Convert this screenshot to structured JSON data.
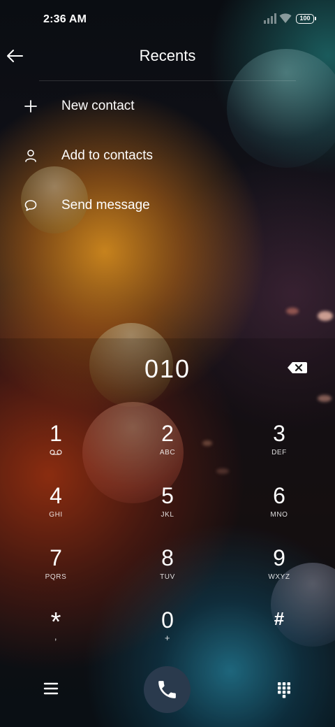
{
  "status_bar": {
    "time": "2:36 AM",
    "battery": "100"
  },
  "header": {
    "title": "Recents"
  },
  "menu": [
    {
      "label": "New contact",
      "icon": "plus-icon"
    },
    {
      "label": "Add to contacts",
      "icon": "person-icon"
    },
    {
      "label": "Send message",
      "icon": "message-bubble-icon"
    }
  ],
  "dialer": {
    "number": "010",
    "keys": [
      {
        "digit": "1",
        "letters": ""
      },
      {
        "digit": "2",
        "letters": "ABC"
      },
      {
        "digit": "3",
        "letters": "DEF"
      },
      {
        "digit": "4",
        "letters": "GHI"
      },
      {
        "digit": "5",
        "letters": "JKL"
      },
      {
        "digit": "6",
        "letters": "MNO"
      },
      {
        "digit": "7",
        "letters": "PQRS"
      },
      {
        "digit": "8",
        "letters": "TUV"
      },
      {
        "digit": "9",
        "letters": "WXYZ"
      },
      {
        "digit": "*",
        "letters": ","
      },
      {
        "digit": "0",
        "letters": "+"
      },
      {
        "digit": "#",
        "letters": ""
      }
    ]
  },
  "icons": {
    "back": "back-arrow-icon",
    "backspace": "backspace-icon",
    "voicemail": "voicemail-icon",
    "menu": "hamburger-menu-icon",
    "call": "phone-icon",
    "dialpad": "dialpad-icon"
  },
  "colors": {
    "call_button": "#2a3a4d",
    "text": "#ffffff"
  }
}
